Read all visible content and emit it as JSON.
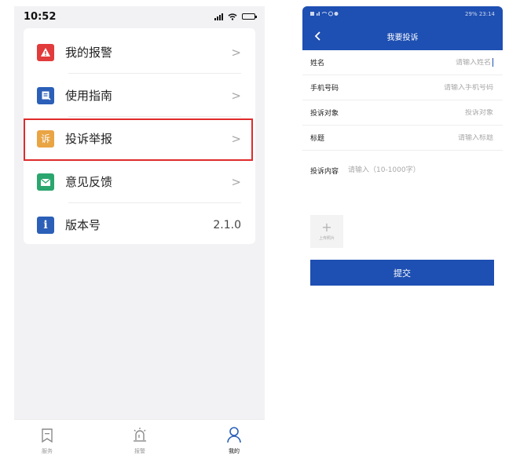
{
  "left": {
    "status": {
      "time": "10:52"
    },
    "menu": [
      {
        "label": "我的报警",
        "icon": "alarm-triangle-icon",
        "icon_color": "#e23b3b",
        "trailing": ">"
      },
      {
        "label": "使用指南",
        "icon": "guide-book-icon",
        "icon_color": "#2b5fb8",
        "trailing": ">"
      },
      {
        "label": "投诉举报",
        "icon": "complaint-icon",
        "icon_glyph": "诉",
        "icon_color": "#e9a444",
        "trailing": ">"
      },
      {
        "label": "意见反馈",
        "icon": "feedback-mail-icon",
        "icon_color": "#2aa66e",
        "trailing": ">"
      },
      {
        "label": "版本号",
        "icon": "info-icon",
        "icon_glyph": "i",
        "icon_color": "#2b5fb8",
        "trailing": "2.1.0"
      }
    ],
    "highlighted_item": "投诉举报",
    "highlight_color": "#e02b2b",
    "tabbar": [
      {
        "label": "服务",
        "icon": "bookmark-icon",
        "active": false
      },
      {
        "label": "报警",
        "icon": "siren-icon",
        "active": false
      },
      {
        "label": "我的",
        "icon": "user-icon",
        "active": true
      }
    ],
    "tab_active_color": "#2b5fb8"
  },
  "right": {
    "status": {
      "left_icons": "sim-signal-wifi-alarm-icons",
      "right_text": "29% 23:14"
    },
    "header_color": "#1e4fb2",
    "title": "我要投诉",
    "form": [
      {
        "label": "姓名",
        "placeholder": "请输入姓名"
      },
      {
        "label": "手机号码",
        "placeholder": "请输入手机号码"
      },
      {
        "label": "投诉对象",
        "placeholder": "投诉对象"
      },
      {
        "label": "标题",
        "placeholder": "请输入标题"
      }
    ],
    "content": {
      "label": "投诉内容",
      "placeholder": "请输入（10-1000字）"
    },
    "upload": {
      "plus": "+",
      "label": "上传照片"
    },
    "submit_label": "提交"
  }
}
